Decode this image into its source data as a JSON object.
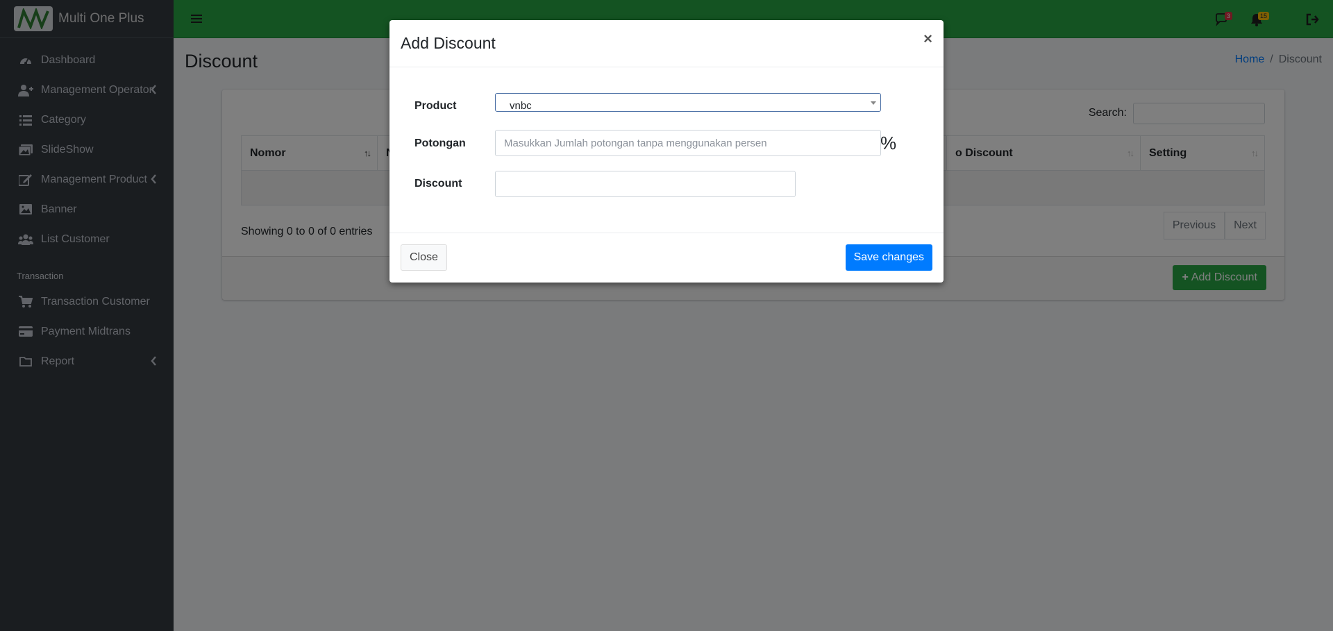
{
  "app": {
    "brand": "Multi One Plus"
  },
  "sidebar": {
    "items": [
      {
        "label": "Dashboard",
        "icon": "dashboard-icon"
      },
      {
        "label": "Management Operator",
        "icon": "user-plus-icon",
        "expandable": true
      },
      {
        "label": "Category",
        "icon": "list-icon"
      },
      {
        "label": "SlideShow",
        "icon": "images-icon"
      },
      {
        "label": "Management Product",
        "icon": "edit-icon",
        "expandable": true
      },
      {
        "label": "Banner",
        "icon": "image-icon"
      },
      {
        "label": "List Customer",
        "icon": "users-icon"
      }
    ],
    "section_header": "Transaction",
    "transaction_items": [
      {
        "label": "Transaction Customer",
        "icon": "cart-icon"
      },
      {
        "label": "Payment Midtrans",
        "icon": "credit-card-icon"
      },
      {
        "label": "Report",
        "icon": "folder-icon",
        "expandable": true
      }
    ]
  },
  "navbar": {
    "messages_count": "3",
    "notifications_count": "15",
    "badge_colors": {
      "messages": "#dc3545",
      "notifications": "#ffc107"
    }
  },
  "page": {
    "title": "Discount",
    "breadcrumb": {
      "home": "Home",
      "separator": "/",
      "current": "Discount"
    }
  },
  "table": {
    "search_label": "Search:",
    "columns": [
      "Nomor",
      "N",
      "",
      "o Discount",
      "Setting"
    ],
    "info": "Showing 0 to 0 of 0 entries",
    "pager": {
      "previous": "Previous",
      "next": "Next"
    },
    "add_button": "Add Discount"
  },
  "modal": {
    "title": "Add Discount",
    "close_symbol": "×",
    "product": {
      "label": "Product",
      "value": "vnbc"
    },
    "potongan": {
      "label": "Potongan",
      "placeholder": "Masukkan Jumlah potongan tanpa menggunakan persen",
      "suffix": "%"
    },
    "discount": {
      "label": "Discount",
      "value": ""
    },
    "close_button": "Close",
    "save_button": "Save changes"
  },
  "colors": {
    "primary": "#007bff",
    "success": "#28a745",
    "sidebar": "#343a40"
  }
}
